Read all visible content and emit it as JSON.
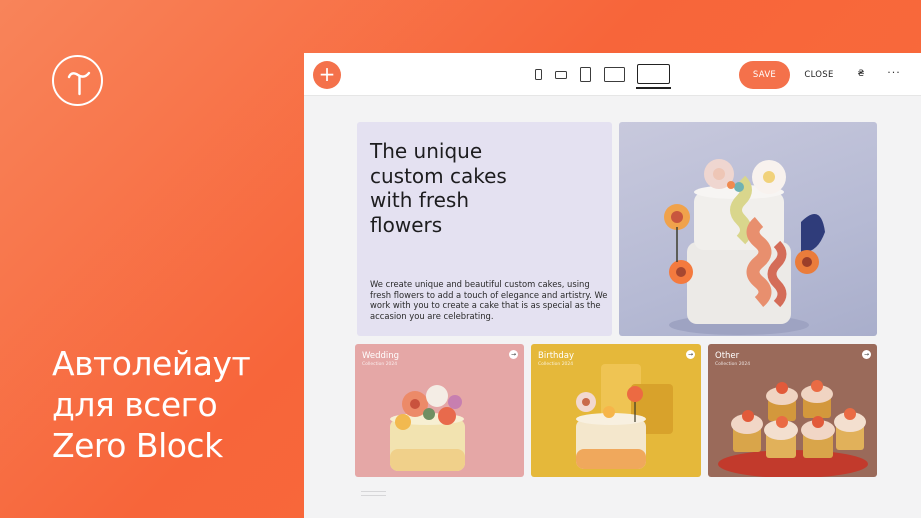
{
  "promo": {
    "lines": [
      "Автолейаут",
      "для всего",
      "Zero Block"
    ]
  },
  "colors": {
    "accent": "#f4714b",
    "background": "#f7653a",
    "hero_panel": "#e4e1f1"
  },
  "toolbar": {
    "add_icon": "+",
    "devices": [
      "phone-small-icon",
      "phone-landscape-icon",
      "tablet-icon",
      "tablet-landscape-icon",
      "desktop-icon"
    ],
    "save_label": "SAVE",
    "close_label": "CLOSE",
    "currency_icon": "₴",
    "more_icon": "···"
  },
  "hero": {
    "title_lines": [
      "The unique",
      "custom cakes",
      "with fresh",
      "flowers"
    ],
    "description": "We create unique and beautiful custom cakes, using fresh flowers to add a touch of elegance and artistry. We work with you to create a cake that is as special as the accasion you are celebrating."
  },
  "cards": [
    {
      "title": "Wedding",
      "subtitle": "Collection 2024",
      "arrow": "→"
    },
    {
      "title": "Birthday",
      "subtitle": "Collection 2024",
      "arrow": "→"
    },
    {
      "title": "Other",
      "subtitle": "Collection 2024",
      "arrow": "→"
    }
  ]
}
